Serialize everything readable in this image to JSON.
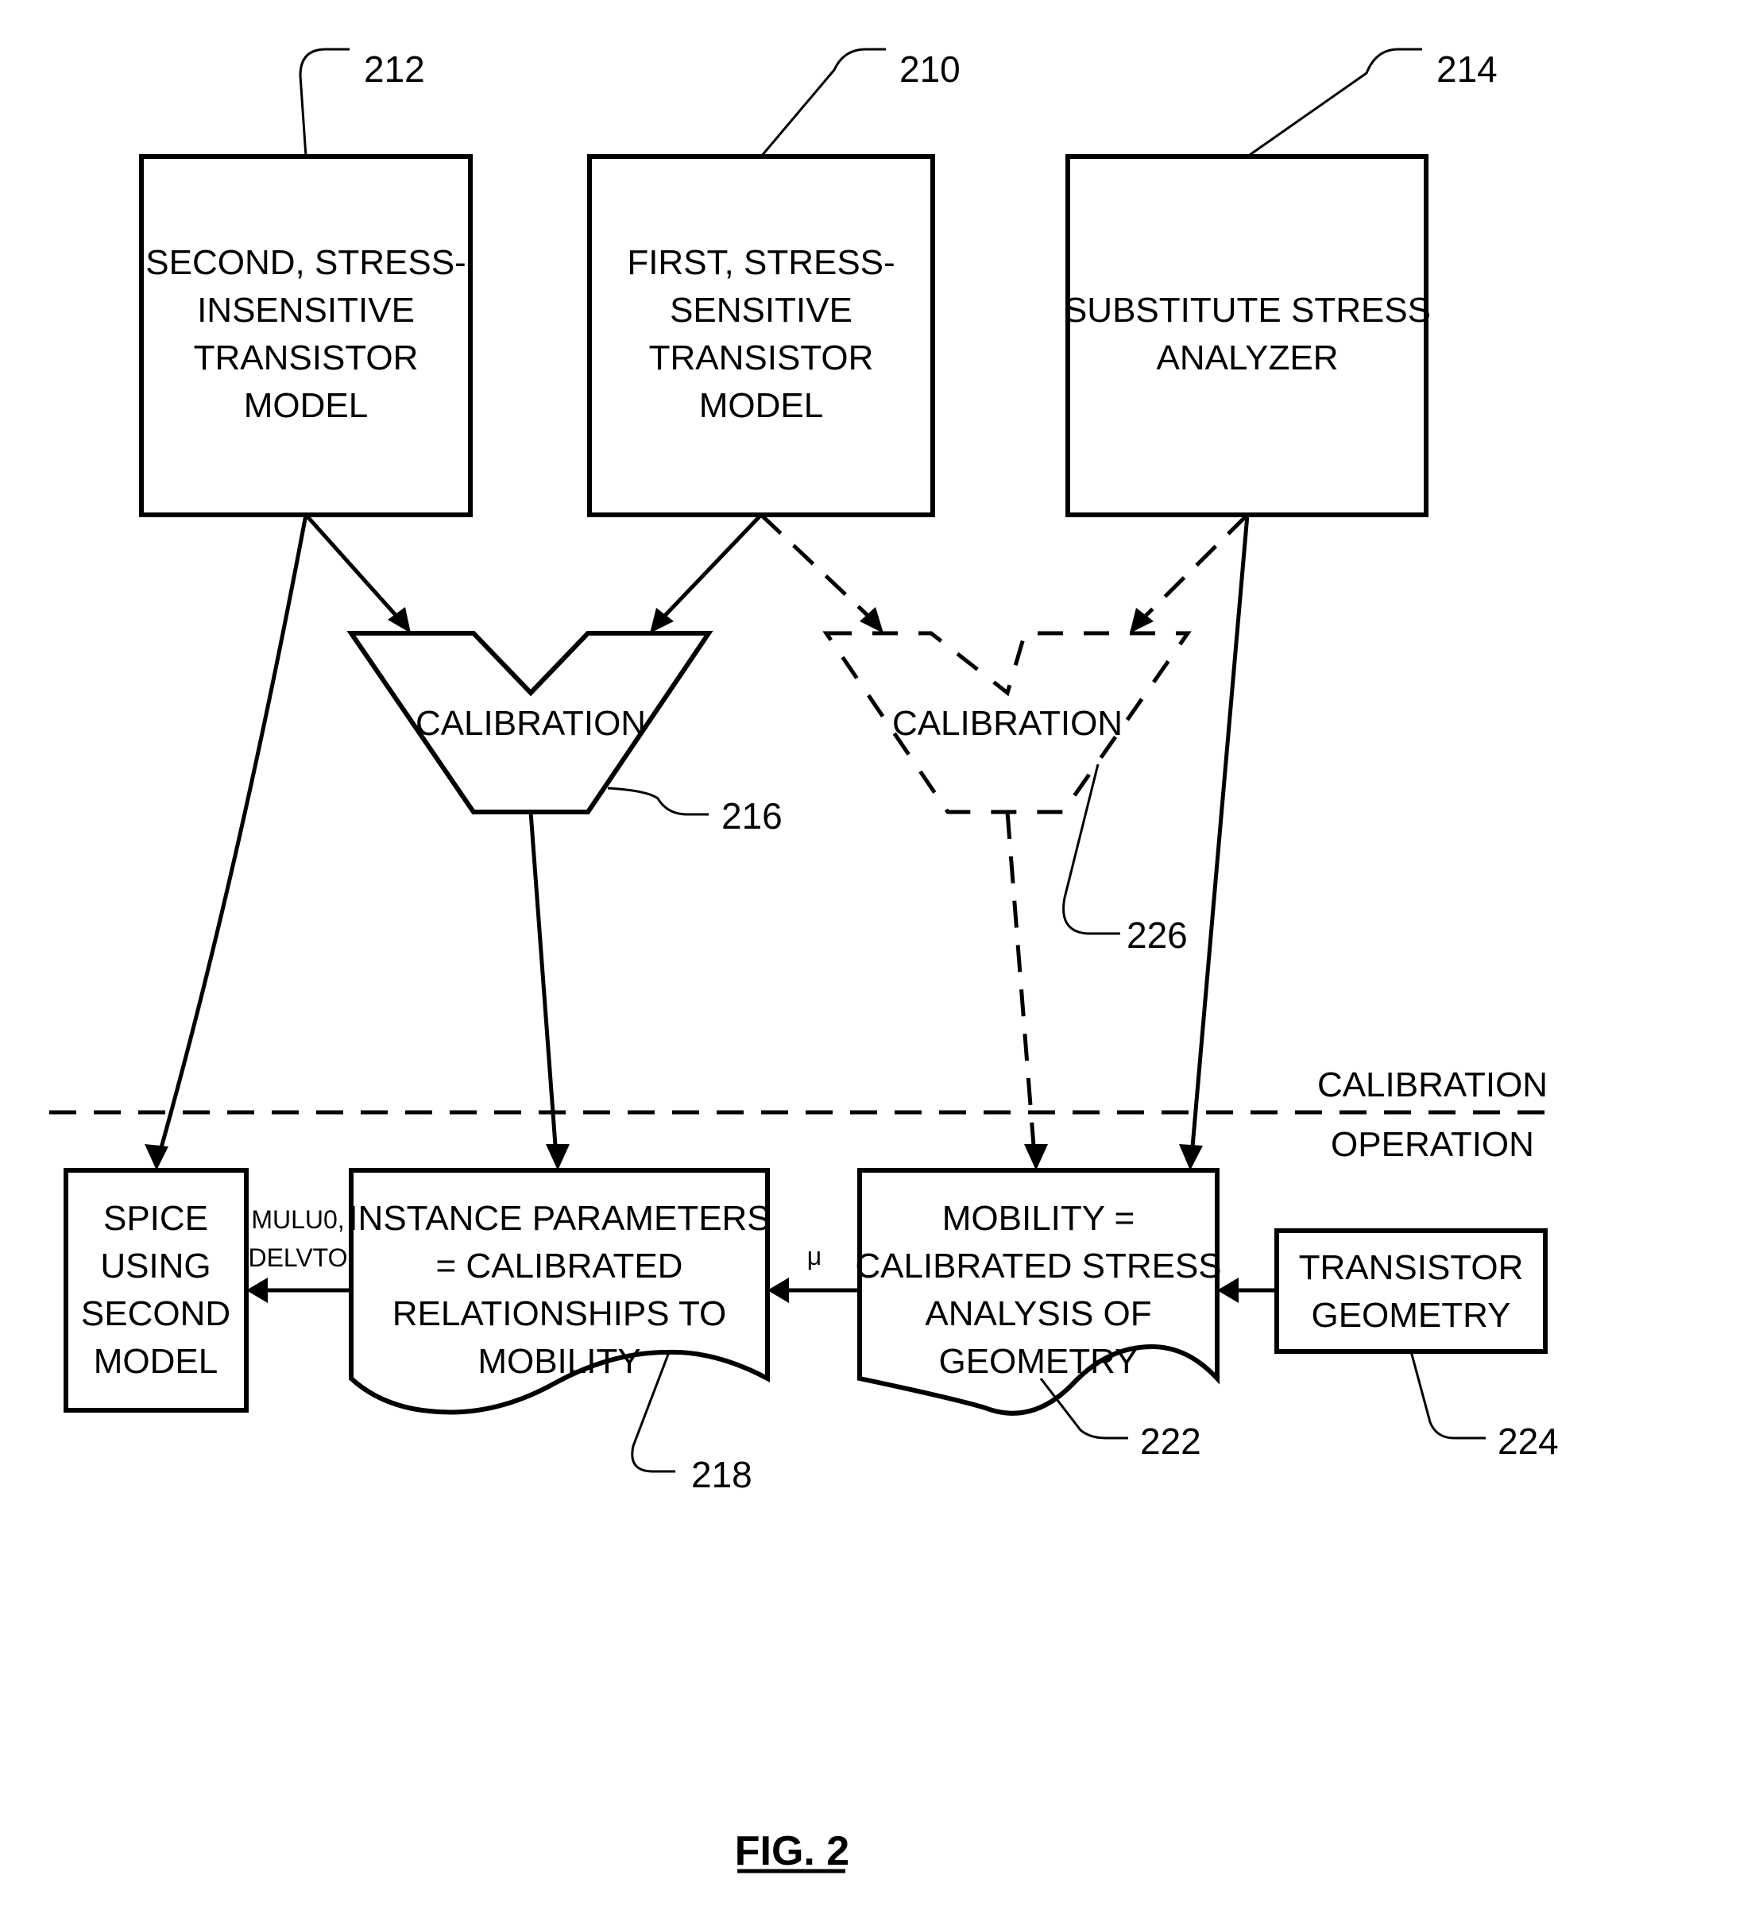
{
  "figure": {
    "title": "FIG. 2"
  },
  "blocks": {
    "second_model": {
      "ref": "212",
      "lines": [
        "SECOND, STRESS-",
        "INSENSITIVE",
        "TRANSISTOR",
        "MODEL"
      ]
    },
    "first_model": {
      "ref": "210",
      "lines": [
        "FIRST, STRESS-",
        "SENSITIVE",
        "TRANSISTOR",
        "MODEL"
      ]
    },
    "stress_analyzer": {
      "ref": "214",
      "lines": [
        "SUBSTITUTE STRESS",
        "ANALYZER"
      ]
    },
    "calibration_solid": {
      "ref": "216",
      "label": "CALIBRATION"
    },
    "calibration_dashed": {
      "ref": "226",
      "label": "CALIBRATION"
    },
    "spice": {
      "lines": [
        "SPICE",
        "USING",
        "SECOND",
        "MODEL"
      ]
    },
    "instance_params": {
      "ref": "218",
      "lines": [
        "INSTANCE PARAMETERS",
        "= CALIBRATED",
        "RELATIONSHIPS TO",
        "MOBILITY"
      ]
    },
    "mobility": {
      "ref": "222",
      "lines": [
        "MOBILITY =",
        "CALIBRATED STRESS",
        "ANALYSIS OF",
        "GEOMETRY"
      ]
    },
    "geometry": {
      "ref": "224",
      "lines": [
        "TRANSISTOR",
        "GEOMETRY"
      ]
    }
  },
  "edge_labels": {
    "params_to_spice": [
      "MULU0,",
      "DELVTO"
    ],
    "mobility_to_params": "μ"
  },
  "divider": {
    "upper_label": "CALIBRATION",
    "lower_label": "OPERATION"
  }
}
